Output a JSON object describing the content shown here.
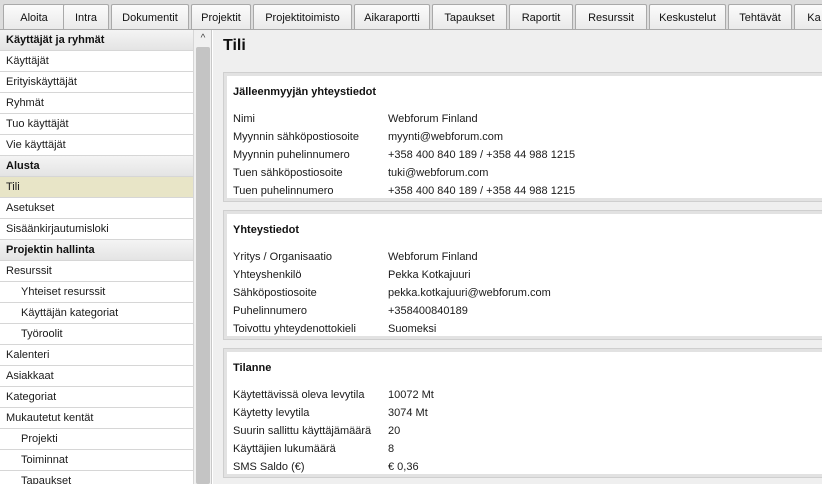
{
  "tabs": [
    "Aloita",
    "Intra",
    "Dokumentit",
    "Projektit",
    "Projektitoimisto",
    "Aikaraportti",
    "Tapaukset",
    "Raportit",
    "Resurssit",
    "Keskustelut",
    "Tehtävät",
    "Ka"
  ],
  "sidebar": {
    "items": [
      {
        "label": "Käyttäjät ja ryhmät",
        "type": "header"
      },
      {
        "label": "Käyttäjät",
        "type": "item"
      },
      {
        "label": "Erityiskäyttäjät",
        "type": "item"
      },
      {
        "label": "Ryhmät",
        "type": "item"
      },
      {
        "label": "Tuo käyttäjät",
        "type": "item"
      },
      {
        "label": "Vie käyttäjät",
        "type": "item"
      },
      {
        "label": "Alusta",
        "type": "header"
      },
      {
        "label": "Tili",
        "type": "item",
        "active": true
      },
      {
        "label": "Asetukset",
        "type": "item"
      },
      {
        "label": "Sisäänkirjautumisloki",
        "type": "item"
      },
      {
        "label": "Projektin hallinta",
        "type": "header"
      },
      {
        "label": "Resurssit",
        "type": "item"
      },
      {
        "label": "Yhteiset resurssit",
        "type": "sub"
      },
      {
        "label": "Käyttäjän kategoriat",
        "type": "sub"
      },
      {
        "label": "Työroolit",
        "type": "sub"
      },
      {
        "label": "Kalenteri",
        "type": "item"
      },
      {
        "label": "Asiakkaat",
        "type": "item"
      },
      {
        "label": "Kategoriat",
        "type": "item"
      },
      {
        "label": "Mukautetut kentät",
        "type": "item"
      },
      {
        "label": "Projekti",
        "type": "sub"
      },
      {
        "label": "Toiminnat",
        "type": "sub"
      },
      {
        "label": "Tapaukset",
        "type": "sub"
      }
    ],
    "scroll_up_glyph": "^"
  },
  "main": {
    "title": "Tili",
    "panels": [
      {
        "title": "Jälleenmyyjän yhteystiedot",
        "rows": [
          {
            "label": "Nimi",
            "value": "Webforum Finland"
          },
          {
            "label": "Myynnin sähköpostiosoite",
            "value": "myynti@webforum.com"
          },
          {
            "label": "Myynnin puhelinnumero",
            "value": "+358 400 840 189 / +358 44 988 1215"
          },
          {
            "label": "Tuen sähköpostiosoite",
            "value": "tuki@webforum.com"
          },
          {
            "label": "Tuen puhelinnumero",
            "value": "+358 400 840 189 / +358 44 988 1215"
          }
        ]
      },
      {
        "title": "Yhteystiedot",
        "rows": [
          {
            "label": "Yritys / Organisaatio",
            "value": "Webforum Finland"
          },
          {
            "label": "Yhteyshenkilö",
            "value": "Pekka Kotkajuuri"
          },
          {
            "label": "Sähköpostiosoite",
            "value": "pekka.kotkajuuri@webforum.com"
          },
          {
            "label": "Puhelinnumero",
            "value": "+358400840189"
          },
          {
            "label": "Toivottu yhteydenottokieli",
            "value": "Suomeksi"
          }
        ]
      },
      {
        "title": "Tilanne",
        "rows": [
          {
            "label": "Käytettävissä oleva levytila",
            "value": "10072 Mt"
          },
          {
            "label": "Käytetty levytila",
            "value": "3074 Mt"
          },
          {
            "label": "Suurin sallittu käyttäjämäärä",
            "value": "20"
          },
          {
            "label": "Käyttäjien lukumäärä",
            "value": "8"
          },
          {
            "label": "SMS Saldo (€)",
            "value": "€ 0,36"
          }
        ]
      }
    ]
  },
  "colors": {
    "active_row": "#e8e5c7",
    "tabbar_bg": "#dcdcdc",
    "main_bg": "#efefef"
  }
}
